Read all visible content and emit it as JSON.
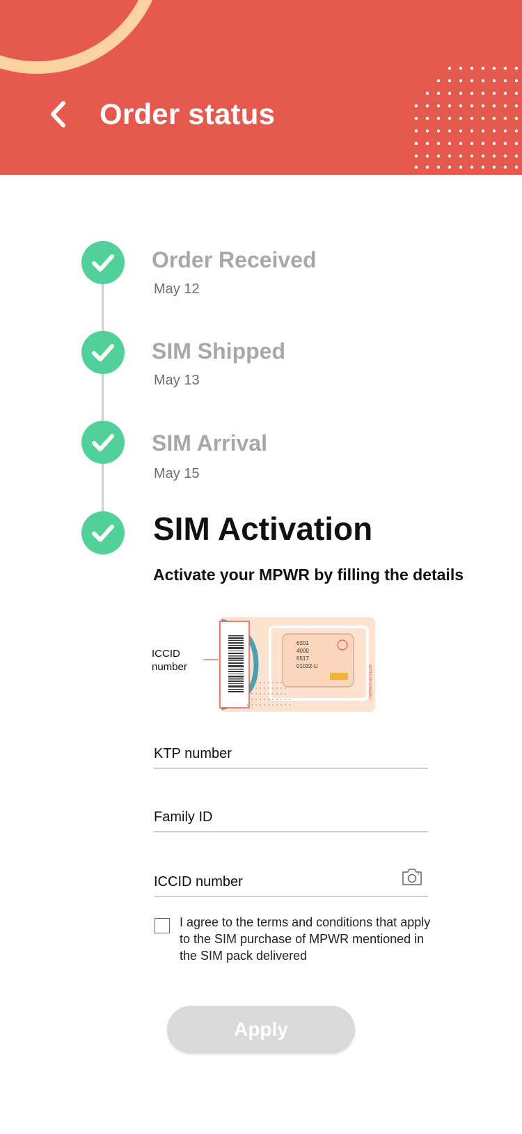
{
  "header": {
    "title": "Order status",
    "back_icon": "chevron-left-icon",
    "background_color": "#e5594e",
    "accent_arc_color": "#fcd3a0"
  },
  "steps": [
    {
      "title": "Order Received",
      "date": "May 12",
      "completed": true
    },
    {
      "title": "SIM Shipped",
      "date": "May 13",
      "completed": true
    },
    {
      "title": "SIM Arrival",
      "date": "May 15",
      "completed": true
    },
    {
      "title": "SIM Activation",
      "completed": true
    }
  ],
  "activation": {
    "subtitle": "Activate your MPWR by filling the details",
    "sim_card": {
      "iccid_label": "ICCID number",
      "card_lines": [
        "6201",
        "4000",
        "6517",
        "01032-U"
      ]
    }
  },
  "form": {
    "ktp_placeholder": "KTP number",
    "family_id_placeholder": "Family ID",
    "iccid_placeholder": "ICCID number",
    "camera_icon": "camera-icon",
    "terms_text": "I agree to the terms and conditions that apply to the SIM purchase of MPWR mentioned in the SIM pack delivered",
    "terms_checked": false,
    "apply_label": "Apply",
    "apply_enabled": false
  },
  "colors": {
    "check_green": "#52d09a",
    "muted_text": "#a8a8a8",
    "button_disabled": "#d9d9d9"
  }
}
